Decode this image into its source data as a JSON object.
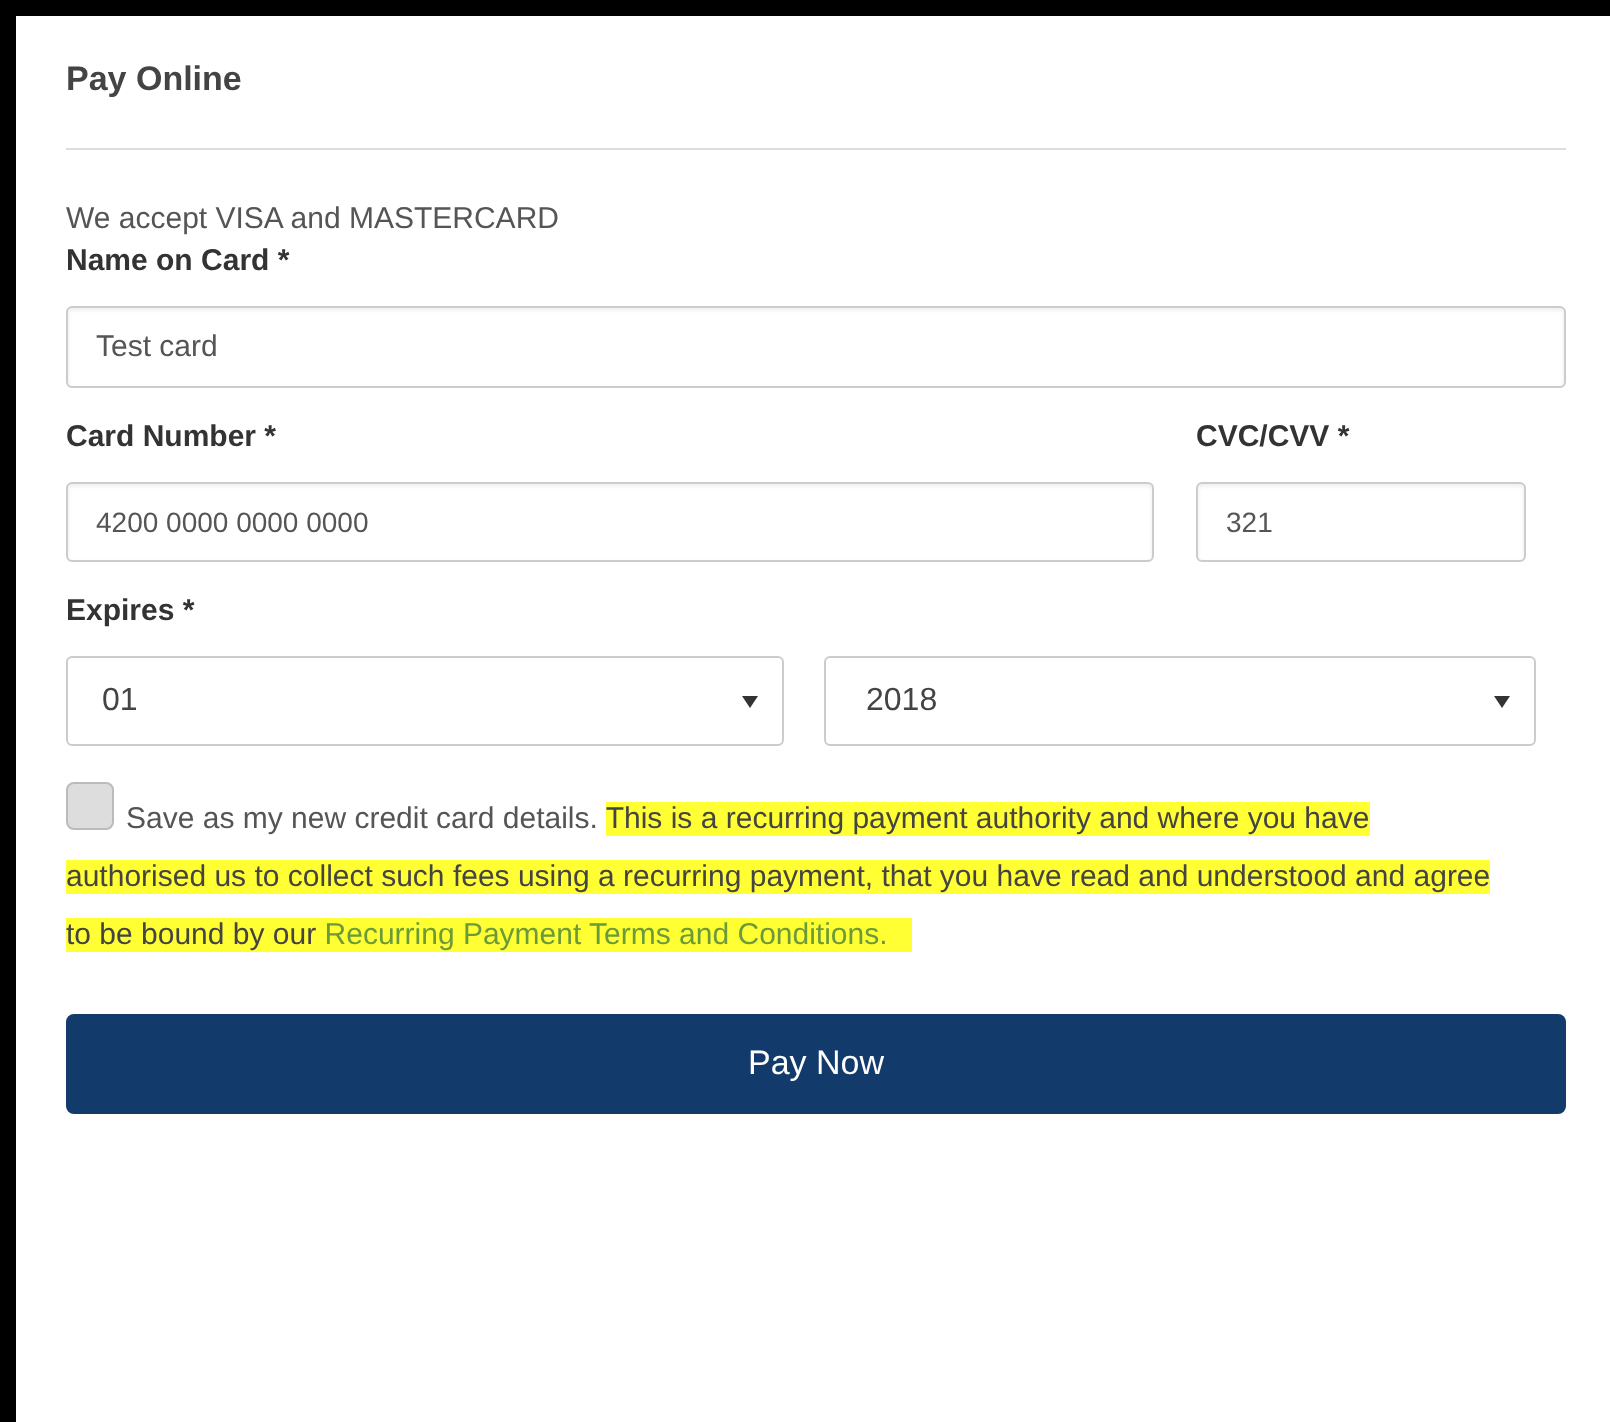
{
  "panel": {
    "title": "Pay Online"
  },
  "intro": "We accept VISA and MASTERCARD",
  "name_field": {
    "label": "Name on Card *",
    "value": "Test card"
  },
  "card_field": {
    "label": "Card Number *",
    "value": "4200 0000 0000 0000"
  },
  "cvc_field": {
    "label": "CVC/CVV *",
    "value": "321"
  },
  "expires": {
    "label": "Expires *",
    "month": "01",
    "year": "2018"
  },
  "save_option": {
    "checked": false,
    "label": "Save as my new credit card details.",
    "notice": "This is a recurring payment authority and where you have authorised us to collect such fees using a recurring payment, that you have read and understood and agree to be bound by our",
    "link": "Recurring Payment Terms and Conditions.",
    "highlighted": true
  },
  "submit": "Pay Now"
}
